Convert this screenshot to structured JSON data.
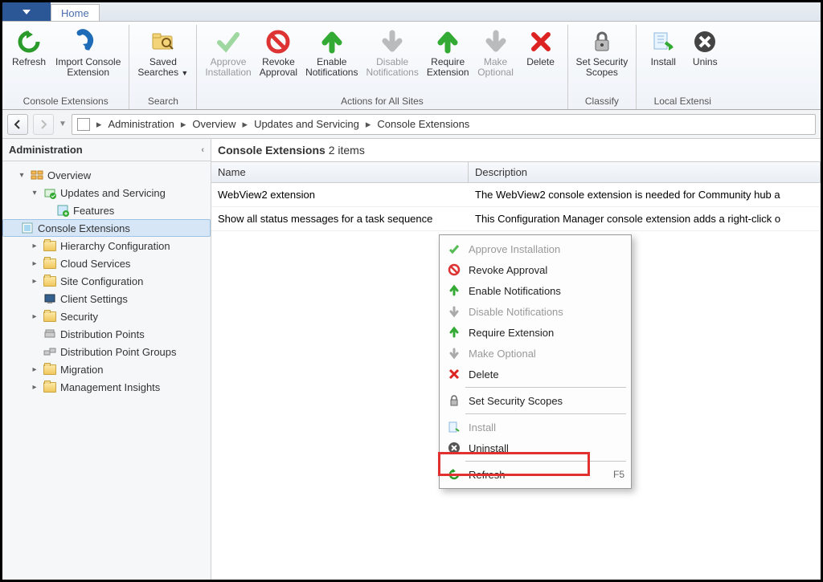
{
  "tabs": {
    "home": "Home"
  },
  "ribbon": {
    "refresh": "Refresh",
    "import": "Import Console\nExtension",
    "group_console": "Console Extensions",
    "saved_searches": "Saved\nSearches",
    "group_search": "Search",
    "approve": "Approve\nInstallation",
    "revoke": "Revoke\nApproval",
    "enable": "Enable\nNotifications",
    "disable": "Disable\nNotifications",
    "require": "Require\nExtension",
    "optional": "Make\nOptional",
    "delete": "Delete",
    "group_actions": "Actions for All Sites",
    "scopes": "Set Security\nScopes",
    "group_classify": "Classify",
    "install": "Install",
    "uninstall": "Unins",
    "group_local": "Local Extensi"
  },
  "breadcrumb": [
    "Administration",
    "Overview",
    "Updates and Servicing",
    "Console Extensions"
  ],
  "sidebar": {
    "title": "Administration",
    "items": [
      {
        "label": "Overview",
        "level": 0,
        "exp": "▾"
      },
      {
        "label": "Updates and Servicing",
        "level": 1,
        "exp": "▾"
      },
      {
        "label": "Features",
        "level": 2
      },
      {
        "label": "Console Extensions",
        "level": 2,
        "selected": true
      },
      {
        "label": "Hierarchy Configuration",
        "level": 1,
        "exp": "▸"
      },
      {
        "label": "Cloud Services",
        "level": 1,
        "exp": "▸"
      },
      {
        "label": "Site Configuration",
        "level": 1,
        "exp": "▸"
      },
      {
        "label": "Client Settings",
        "level": 1
      },
      {
        "label": "Security",
        "level": 1,
        "exp": "▸"
      },
      {
        "label": "Distribution Points",
        "level": 1
      },
      {
        "label": "Distribution Point Groups",
        "level": 1
      },
      {
        "label": "Migration",
        "level": 1,
        "exp": "▸"
      },
      {
        "label": "Management Insights",
        "level": 1,
        "exp": "▸"
      }
    ]
  },
  "content": {
    "title": "Console Extensions",
    "count": "2 items",
    "columns": {
      "name": "Name",
      "desc": "Description"
    },
    "rows": [
      {
        "name": "WebView2 extension",
        "desc": "The WebView2 console extension is needed for Community hub a"
      },
      {
        "name": "Show all status messages for a task sequence",
        "desc": "This Configuration Manager console extension adds a right-click o"
      }
    ]
  },
  "context_menu": [
    {
      "label": "Approve Installation",
      "icon": "check",
      "disabled": true
    },
    {
      "label": "Revoke Approval",
      "icon": "prohibit"
    },
    {
      "label": "Enable Notifications",
      "icon": "arrow-up-green"
    },
    {
      "label": "Disable Notifications",
      "icon": "arrow-down-gray",
      "disabled": true
    },
    {
      "label": "Require Extension",
      "icon": "arrow-up-green"
    },
    {
      "label": "Make Optional",
      "icon": "arrow-down-gray",
      "disabled": true
    },
    {
      "label": "Delete",
      "icon": "x-red",
      "sep_after": true
    },
    {
      "label": "Set Security Scopes",
      "icon": "lock",
      "sep_after": true
    },
    {
      "label": "Install",
      "icon": "install",
      "disabled": true
    },
    {
      "label": "Uninstall",
      "icon": "uninstall",
      "highlight": true,
      "sep_after": true
    },
    {
      "label": "Refresh",
      "icon": "refresh",
      "shortcut": "F5"
    }
  ]
}
